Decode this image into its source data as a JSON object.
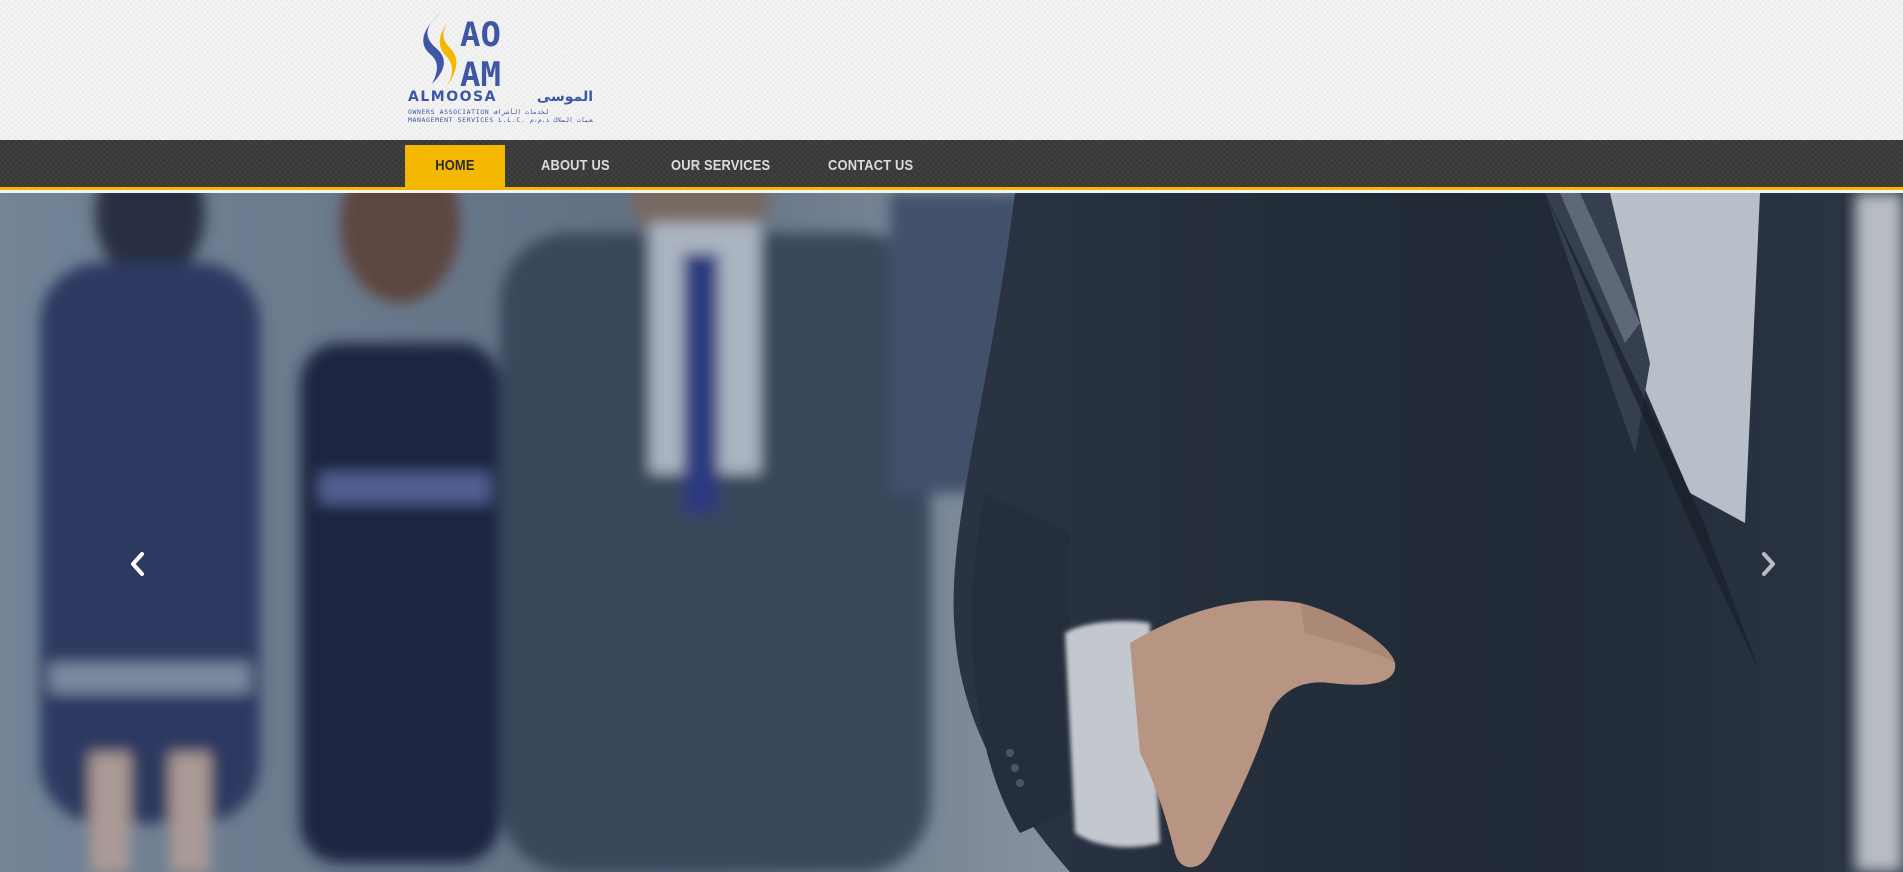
{
  "brand": {
    "monogram_top": "AO",
    "monogram_bottom": "AM",
    "wordmark": "ALMOOSA",
    "arabic": "الموسى",
    "tagline_line1": "OWNERS ASSOCIATION لخدمات الأشراف",
    "tagline_line2": "MANAGEMENT SERVICES L.L.C. الإداري لجمعيات الملاك ذ.م.م",
    "colors": {
      "blue": "#3f56a6",
      "gold": "#f5b800"
    }
  },
  "nav": {
    "items": [
      {
        "label": "HOME",
        "active": true
      },
      {
        "label": "ABOUT US",
        "active": false
      },
      {
        "label": "OUR SERVICES",
        "active": false
      },
      {
        "label": "CONTACT US",
        "active": false
      }
    ]
  },
  "slider": {
    "prev_icon": "chevron-left-icon",
    "next_icon": "chevron-right-icon",
    "image": "business people handshake"
  }
}
